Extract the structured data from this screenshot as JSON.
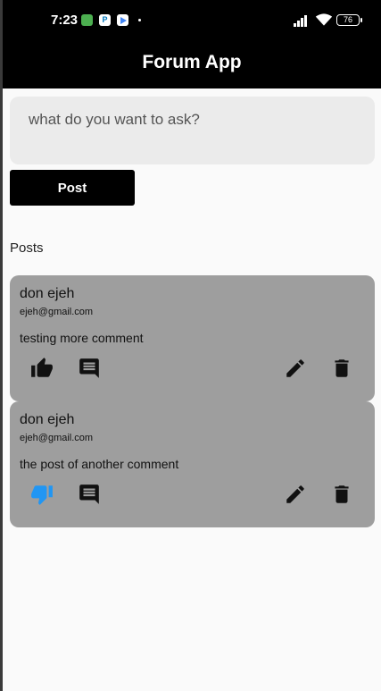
{
  "status_bar": {
    "time": "7:23",
    "battery": "76",
    "app_icon_p": "P"
  },
  "app_bar": {
    "title": "Forum App"
  },
  "composer": {
    "placeholder": "what do you want to ask?",
    "post_label": "Post"
  },
  "posts_heading": "Posts",
  "posts": [
    {
      "author": "don ejeh",
      "email": "ejeh@gmail.com",
      "body": "testing more comment",
      "reaction": "like",
      "reaction_color": "#111111"
    },
    {
      "author": "don ejeh",
      "email": "ejeh@gmail.com",
      "body": "the post of another comment",
      "reaction": "dislike",
      "reaction_color": "#2196f3"
    }
  ],
  "icons": [
    "thumb-up-icon",
    "thumb-down-icon",
    "comment-icon",
    "edit-icon",
    "delete-icon"
  ]
}
